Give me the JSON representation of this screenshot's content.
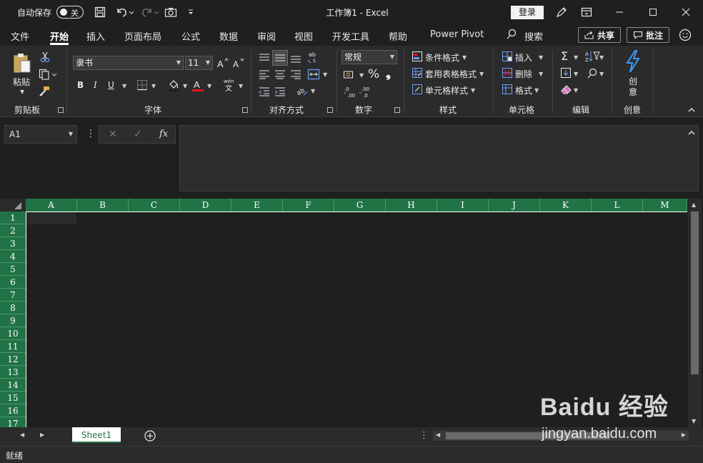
{
  "titlebar": {
    "autosave_label": "自动保存",
    "autosave_state": "关",
    "window_title": "工作簿1  -  Excel",
    "login_label": "登录"
  },
  "tabs": [
    {
      "label": "文件"
    },
    {
      "label": "开始"
    },
    {
      "label": "插入"
    },
    {
      "label": "页面布局"
    },
    {
      "label": "公式"
    },
    {
      "label": "数据"
    },
    {
      "label": "审阅"
    },
    {
      "label": "视图"
    },
    {
      "label": "开发工具"
    },
    {
      "label": "帮助"
    },
    {
      "label": "Power Pivot"
    },
    {
      "label": "搜索"
    }
  ],
  "active_tab": "开始",
  "share_label": "共享",
  "comment_label": "批注",
  "ribbon": {
    "clipboard": {
      "paste_label": "粘贴",
      "group_label": "剪贴板"
    },
    "font": {
      "font_name": "隶书",
      "font_size": "11",
      "group_label": "字体",
      "phonetic": "wén"
    },
    "alignment": {
      "group_label": "对齐方式"
    },
    "number": {
      "format": "常规",
      "group_label": "数字"
    },
    "styles": {
      "conditional_format": "条件格式",
      "table_format": "套用表格格式",
      "cell_styles": "单元格样式",
      "group_label": "样式"
    },
    "cells": {
      "insert": "插入",
      "delete": "删除",
      "format": "格式",
      "group_label": "单元格"
    },
    "editing": {
      "group_label": "编辑"
    },
    "creativity": {
      "label_1": "创",
      "label_2": "意",
      "group_label": "创意"
    }
  },
  "formula_bar": {
    "name_box": "A1",
    "fx_label": "fx"
  },
  "columns": [
    "A",
    "B",
    "C",
    "D",
    "E",
    "F",
    "G",
    "H",
    "I",
    "J",
    "K",
    "L",
    "M"
  ],
  "rows": [
    "1",
    "2",
    "3",
    "4",
    "5",
    "6",
    "7",
    "8",
    "9",
    "10",
    "11",
    "12",
    "13",
    "14",
    "15",
    "16",
    "17"
  ],
  "sheets": [
    {
      "label": "Sheet1"
    }
  ],
  "status": {
    "text": "就绪"
  },
  "watermark": {
    "logo": "Baidu 经验",
    "url": "jingyan.baidu.com"
  },
  "colors": {
    "accent": "#217346",
    "background": "#1f1f1f",
    "ribbon": "#2b2b2b"
  }
}
